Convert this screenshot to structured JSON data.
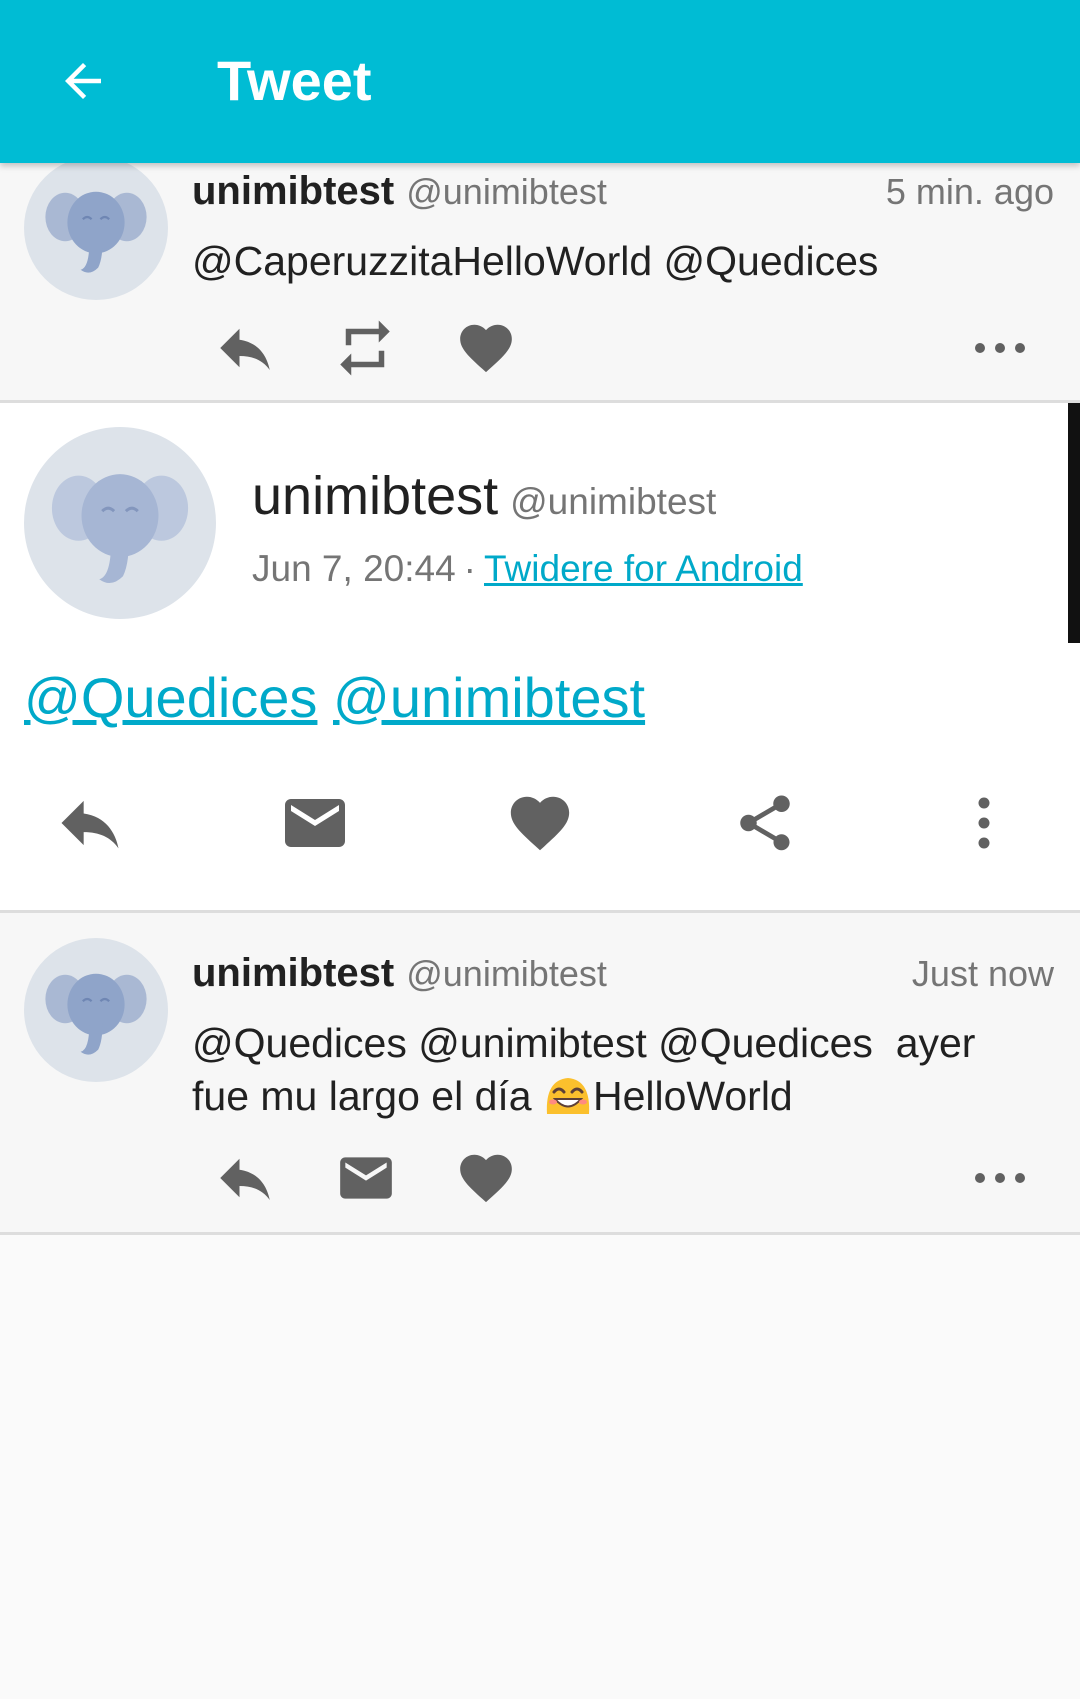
{
  "appbar": {
    "title": "Tweet",
    "back_icon": "arrow-left-icon",
    "color": "#00bcd4"
  },
  "tweets_before": [
    {
      "name": "unimibtest",
      "handle": "@unimibtest",
      "time": "5 min. ago",
      "text": "@CaperuzzitaHelloWorld @Quedices",
      "actions": [
        "reply-icon",
        "retweet-icon",
        "heart-icon",
        "more-horizontal-icon"
      ]
    }
  ],
  "main_tweet": {
    "name": "unimibtest",
    "handle": "@unimibtest",
    "date": "Jun 7, 20:44",
    "separator": "·",
    "source": "Twidere for Android",
    "mentions": [
      "@Quedices",
      "@unimibtest"
    ],
    "actions": [
      "reply-icon",
      "mail-icon",
      "heart-icon",
      "share-icon",
      "more-vertical-icon"
    ],
    "link_color": "#00a9c9"
  },
  "tweets_after": [
    {
      "name": "unimibtest",
      "handle": "@unimibtest",
      "time": "Just now",
      "text_line1": "@Quedices @unimibtest @Quedices  ayer",
      "text_line2_before": "fue mu largo el día ",
      "emoji": "smiling-face-emoji",
      "text_line2_after": "HelloWorld",
      "actions": [
        "reply-icon",
        "mail-icon",
        "heart-icon",
        "more-horizontal-icon"
      ]
    }
  ]
}
